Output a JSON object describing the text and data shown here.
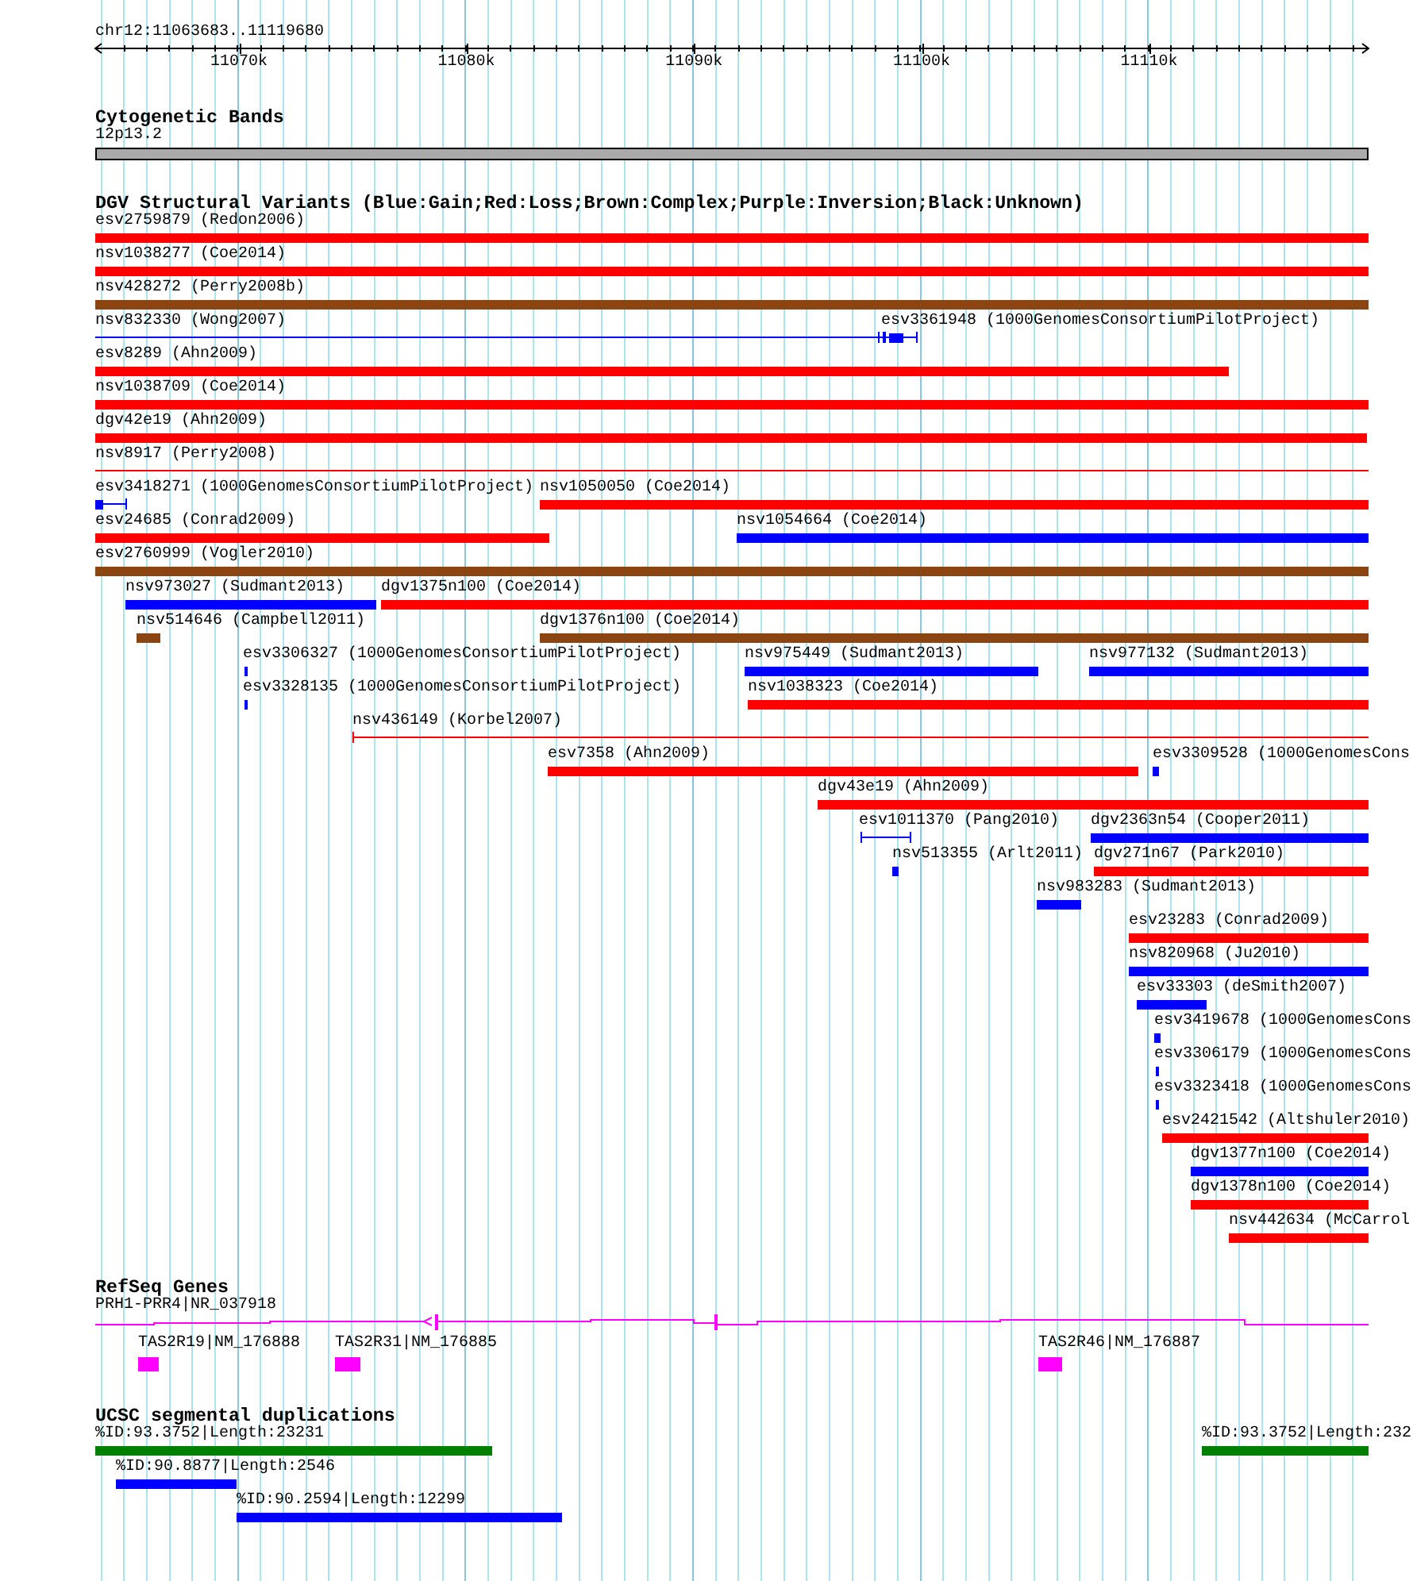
{
  "ruler": {
    "region": "chr12:11063683..11119680",
    "ticks": [
      "11070k",
      "11080k",
      "11090k",
      "11100k",
      "11110k"
    ]
  },
  "tracks": [
    {
      "kind": "cytoband",
      "title": "Cytogenetic Bands",
      "band": {
        "label": "12p13.2"
      }
    },
    {
      "kind": "variants",
      "title": "DGV Structural Variants (Blue:Gain;Red:Loss;Brown:Complex;Purple:Inversion;Black:Unknown)",
      "rows": [
        [
          {
            "label": "esv2759879 (Redon2006)",
            "color": "#ff0000",
            "kind": "bar"
          }
        ],
        [
          {
            "label": "nsv1038277 (Coe2014)",
            "color": "#ff0000",
            "kind": "bar"
          }
        ],
        [
          {
            "label": "nsv428272 (Perry2008b)",
            "color": "#8b4513",
            "kind": "bar"
          }
        ],
        [
          {
            "label": "nsv832330 (Wong2007)",
            "color": "#0000ff",
            "kind": "line"
          },
          {
            "label": "esv3361948 (1000GenomesConsortiumPilotProject)",
            "color": "#0000ff",
            "kind": "segmented"
          }
        ],
        [
          {
            "label": "esv8289 (Ahn2009)",
            "color": "#ff0000",
            "kind": "bar"
          }
        ],
        [
          {
            "label": "nsv1038709 (Coe2014)",
            "color": "#ff0000",
            "kind": "bar"
          }
        ],
        [
          {
            "label": "dgv42e19 (Ahn2009)",
            "color": "#ff0000",
            "kind": "bar"
          }
        ],
        [
          {
            "label": "nsv8917 (Perry2008)",
            "color": "#ff0000",
            "kind": "line"
          }
        ],
        [
          {
            "label": "esv3418271 (1000GenomesConsortiumPilotProject)",
            "color": "#0000ff",
            "kind": "segmented"
          },
          {
            "label": "nsv1050050 (Coe2014)",
            "color": "#ff0000",
            "kind": "bar"
          }
        ],
        [
          {
            "label": "esv24685 (Conrad2009)",
            "color": "#ff0000",
            "kind": "bar"
          },
          {
            "label": "nsv1054664 (Coe2014)",
            "color": "#0000ff",
            "kind": "bar"
          }
        ],
        [
          {
            "label": "esv2760999 (Vogler2010)",
            "color": "#8b4513",
            "kind": "bar"
          }
        ],
        [
          {
            "label": "nsv973027 (Sudmant2013)",
            "color": "#0000ff",
            "kind": "bar"
          },
          {
            "label": "dgv1375n100 (Coe2014)",
            "color": "#ff0000",
            "kind": "bar"
          }
        ],
        [
          {
            "label": "nsv514646 (Campbell2011)",
            "color": "#8b4513",
            "kind": "bar"
          },
          {
            "label": "dgv1376n100 (Coe2014)",
            "color": "#8b4513",
            "kind": "bar"
          }
        ],
        [
          {
            "label": "esv3306327 (1000GenomesConsortiumPilotProject)",
            "color": "#0000ff",
            "kind": "bar"
          },
          {
            "label": "nsv975449 (Sudmant2013)",
            "color": "#0000ff",
            "kind": "bar"
          },
          {
            "label": "nsv977132 (Sudmant2013)",
            "color": "#0000ff",
            "kind": "bar"
          }
        ],
        [
          {
            "label": "esv3328135 (1000GenomesConsortiumPilotProject)",
            "color": "#0000ff",
            "kind": "bar"
          },
          {
            "label": "nsv1038323 (Coe2014)",
            "color": "#ff0000",
            "kind": "bar"
          }
        ],
        [
          {
            "label": "nsv436149 (Korbel2007)",
            "color": "#ff0000",
            "kind": "line"
          }
        ],
        [
          {
            "label": "esv7358 (Ahn2009)",
            "color": "#ff0000",
            "kind": "bar"
          },
          {
            "label": "esv3309528 (1000GenomesCons",
            "color": "#0000ff",
            "kind": "bar"
          }
        ],
        [
          {
            "label": "dgv43e19 (Ahn2009)",
            "color": "#ff0000",
            "kind": "bar"
          }
        ],
        [
          {
            "label": "esv1011370 (Pang2010)",
            "color": "#0000ff",
            "kind": "line"
          },
          {
            "label": "dgv2363n54 (Cooper2011)",
            "color": "#0000ff",
            "kind": "bar"
          }
        ],
        [
          {
            "label": "nsv513355 (Arlt2011)",
            "color": "#0000ff",
            "kind": "bar"
          },
          {
            "label": "dgv271n67 (Park2010)",
            "color": "#ff0000",
            "kind": "bar"
          }
        ],
        [
          {
            "label": "nsv983283 (Sudmant2013)",
            "color": "#0000ff",
            "kind": "bar"
          }
        ],
        [
          {
            "label": "esv23283 (Conrad2009)",
            "color": "#ff0000",
            "kind": "bar"
          }
        ],
        [
          {
            "label": "nsv820968 (Ju2010)",
            "color": "#0000ff",
            "kind": "bar"
          }
        ],
        [
          {
            "label": "esv33303 (deSmith2007)",
            "color": "#0000ff",
            "kind": "bar"
          }
        ],
        [
          {
            "label": "esv3419678 (1000GenomesCons",
            "color": "#0000ff",
            "kind": "bar"
          }
        ],
        [
          {
            "label": "esv3306179 (1000GenomesCons",
            "color": "#0000ff",
            "kind": "bar"
          }
        ],
        [
          {
            "label": "esv3323418 (1000GenomesCons",
            "color": "#0000ff",
            "kind": "bar"
          }
        ],
        [
          {
            "label": "esv2421542 (Altshuler2010)",
            "color": "#ff0000",
            "kind": "bar"
          }
        ],
        [
          {
            "label": "dgv1377n100 (Coe2014)",
            "color": "#0000ff",
            "kind": "bar"
          }
        ],
        [
          {
            "label": "dgv1378n100 (Coe2014)",
            "color": "#ff0000",
            "kind": "bar"
          }
        ],
        [
          {
            "label": "nsv442634 (McCarrol",
            "color": "#ff0000",
            "kind": "bar"
          }
        ]
      ]
    },
    {
      "kind": "genes",
      "title": "RefSeq Genes",
      "rows": [
        [
          {
            "label": "PRH1-PRR4|NR_037918",
            "kind": "transcript"
          }
        ],
        [
          {
            "label": "TAS2R19|NM_176888",
            "kind": "bar"
          },
          {
            "label": "TAS2R31|NM_176885",
            "kind": "bar"
          },
          {
            "label": "TAS2R46|NM_176887",
            "kind": "bar"
          }
        ]
      ]
    },
    {
      "kind": "duplications",
      "title": "UCSC segmental duplications",
      "rows": [
        [
          {
            "label": "%ID:93.3752|Length:23231",
            "color": "#008000",
            "kind": "bar"
          },
          {
            "label": "%ID:93.3752|Length:232",
            "color": "#008000",
            "kind": "bar"
          }
        ],
        [
          {
            "label": "%ID:90.8877|Length:2546",
            "color": "#0000ff",
            "kind": "bar"
          }
        ],
        [
          {
            "label": "%ID:90.2594|Length:12299",
            "color": "#0000ff",
            "kind": "bar"
          }
        ]
      ]
    }
  ]
}
